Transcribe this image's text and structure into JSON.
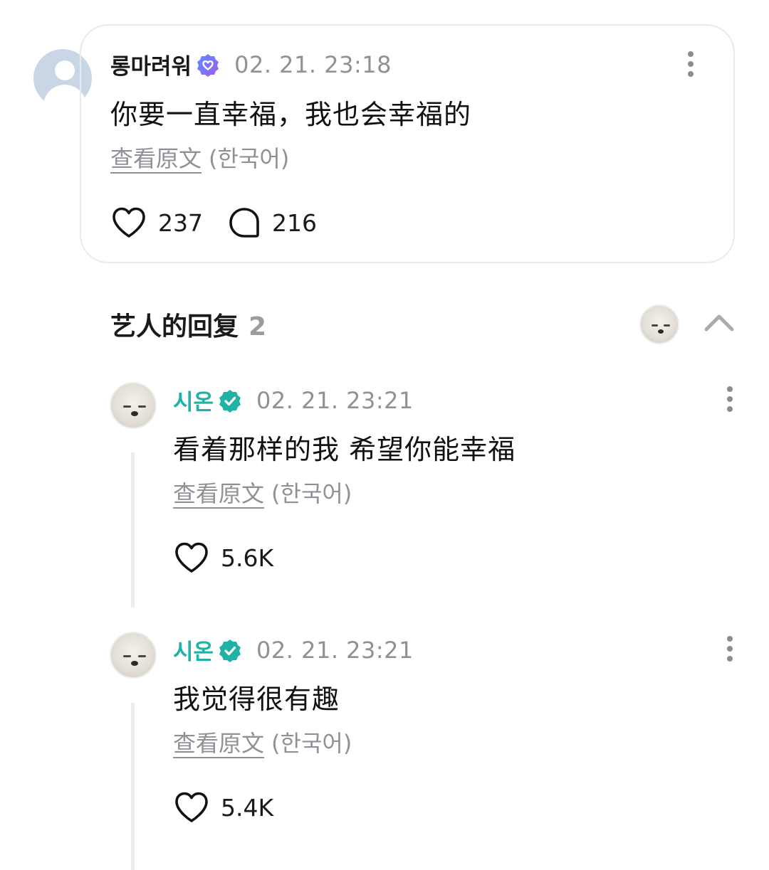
{
  "comment": {
    "username": "롱마려워",
    "timestamp": "02. 21. 23:18",
    "text": "你要一直幸福，我也会幸福的",
    "translate_link": "查看原文",
    "translate_lang": "(한국어)",
    "likes": "237",
    "replies": "216"
  },
  "artist_replies": {
    "title": "艺人的回复",
    "count": "2",
    "items": [
      {
        "username": "시온",
        "timestamp": "02. 21. 23:21",
        "text": "看着那样的我 希望你能幸福",
        "translate_link": "查看原文",
        "translate_lang": "(한국어)",
        "likes": "5.6K"
      },
      {
        "username": "시온",
        "timestamp": "02. 21. 23:21",
        "text": "我觉得很有趣",
        "translate_link": "查看原文",
        "translate_lang": "(한국어)",
        "likes": "5.4K"
      }
    ]
  },
  "colors": {
    "artist_name": "#1fb3a6",
    "fan_badge": "#7a6cf0",
    "artist_badge": "#1fb3a6",
    "muted_text": "#8e9196"
  },
  "icons": {
    "fan_badge": "fan-badge-icon",
    "artist_badge": "verified-badge-icon",
    "like": "heart-icon",
    "reply": "speech-bubble-icon",
    "more": "kebab-menu-icon",
    "collapse": "chevron-up-icon"
  }
}
